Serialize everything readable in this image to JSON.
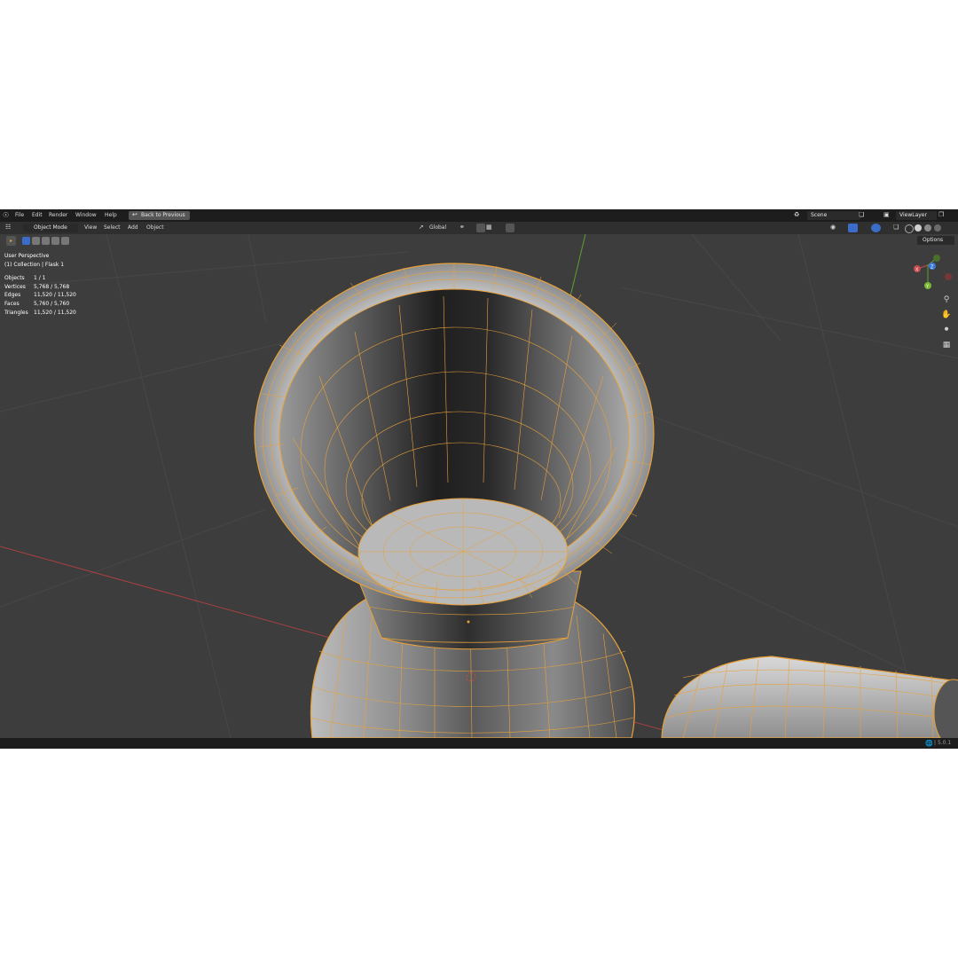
{
  "menu": {
    "items": [
      "File",
      "Edit",
      "Render",
      "Window",
      "Help"
    ],
    "back_label": "Back to Previous",
    "scene": "Scene",
    "view_layer": "ViewLayer"
  },
  "header": {
    "mode": "Object Mode",
    "menus": [
      "View",
      "Select",
      "Add",
      "Object"
    ],
    "orientation": "Global"
  },
  "toolbar": {
    "options_label": "Options"
  },
  "overlay": {
    "perspective": "User Perspective",
    "collection": "(1) Collection | Flask 1",
    "stats": [
      {
        "label": "Objects",
        "value": "1 / 1"
      },
      {
        "label": "Vertices",
        "value": "5,768 / 5,768"
      },
      {
        "label": "Edges",
        "value": "11,520 / 11,520"
      },
      {
        "label": "Faces",
        "value": "5,760 / 5,760"
      },
      {
        "label": "Triangles",
        "value": "11,520 / 11,520"
      }
    ]
  },
  "gizmo": {
    "x": "X",
    "y": "Y",
    "z": "Z"
  },
  "status": {
    "version": "5.0.1"
  },
  "colors": {
    "wire": "#e8a13a",
    "x_axis": "#c64b4b",
    "y_axis": "#7ab837",
    "z_axis": "#3c78d8",
    "viewport_bg": "#3d3d3d"
  },
  "icons": {
    "logo": "blender-logo-icon",
    "zoom": "zoom-icon",
    "pan": "hand-icon",
    "camera": "camera-icon",
    "grid": "grid-icon",
    "world": "globe-icon"
  }
}
